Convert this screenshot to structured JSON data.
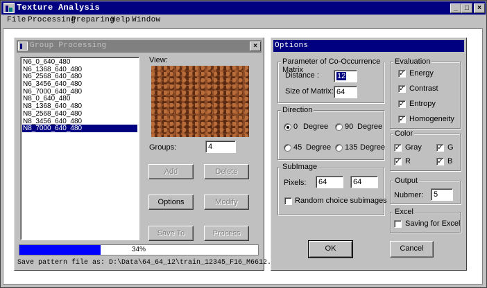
{
  "app": {
    "title": "Texture Analysis"
  },
  "menu": [
    "File",
    "Processing",
    "Preparing",
    "Help",
    "Window"
  ],
  "window_controls": {
    "minimize": "_",
    "maximize": "□",
    "close": "×"
  },
  "group_window": {
    "title": "Group Processing",
    "close_glyph": "×",
    "files": [
      "N6_0_640_480",
      "N6_1368_640_480",
      "N6_2568_640_480",
      "N6_3456_640_480",
      "N6_7000_640_480",
      "N8_0_640_480",
      "N8_1368_640_480",
      "N8_2568_640_480",
      "N8_3456_640_480",
      "N8_7000_640_480"
    ],
    "selected_index": 9,
    "view_label": "View:",
    "groups_label": "Groups:",
    "groups_value": "4",
    "buttons": {
      "add": "Add",
      "delete": "Delete",
      "options": "Options",
      "modify": "Modify",
      "save_to": "Save To",
      "process": "Process"
    },
    "progress": {
      "fraction": 0.34,
      "text": "34%"
    },
    "status": "Save pattern file as: D:\\Data\\64_64_12\\train_12345_F16_M6612.pat"
  },
  "options_window": {
    "title": "Options",
    "cooccurrence": {
      "label": "Parameter of Co-Occurrence Matrix",
      "distance_label": "Distance :",
      "distance_value": "12",
      "size_label": "Size of Matrix:",
      "size_value": "64"
    },
    "direction": {
      "label": "Direction",
      "options": [
        {
          "value": "0",
          "unit": "Degree",
          "checked": true
        },
        {
          "value": "90",
          "unit": "Degree",
          "checked": false
        },
        {
          "value": "45",
          "unit": "Degree",
          "checked": false
        },
        {
          "value": "135",
          "unit": "Degree",
          "checked": false
        }
      ]
    },
    "subimage": {
      "label": "SubImage",
      "pixels_label": "Pixels:",
      "pixels_w": "64",
      "pixels_h": "64",
      "random_label": "Random choice subimages",
      "random_checked": false
    },
    "evaluation": {
      "label": "Evaluation",
      "items": [
        {
          "label": "Energy",
          "checked": true
        },
        {
          "label": "Contrast",
          "checked": true
        },
        {
          "label": "Entropy",
          "checked": true
        },
        {
          "label": "Homogeneity",
          "checked": true
        }
      ]
    },
    "color": {
      "label": "Color",
      "items": [
        {
          "label": "Gray",
          "checked": true
        },
        {
          "label": "G",
          "checked": true
        },
        {
          "label": "R",
          "checked": true
        },
        {
          "label": "B",
          "checked": true
        }
      ]
    },
    "output": {
      "label": "Output",
      "number_label": "Nubmer:",
      "number_value": "5"
    },
    "excel": {
      "label": "Excel",
      "saving_label": "Saving for Excel",
      "checked": false
    },
    "ok_label": "OK",
    "cancel_label": "Cancel",
    "check_glyph": "✓"
  }
}
